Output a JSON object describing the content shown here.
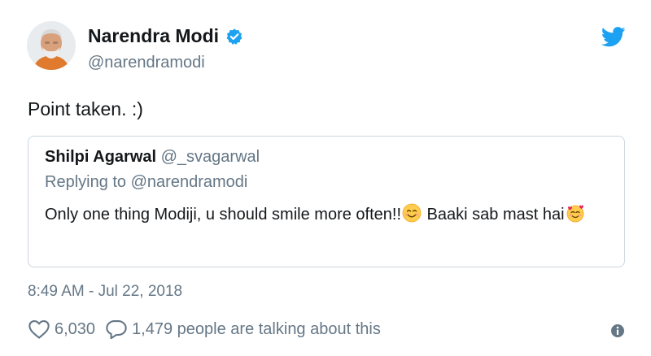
{
  "author": {
    "name": "Narendra Modi",
    "handle": "@narendramodi"
  },
  "tweet": {
    "text": "Point taken. :)"
  },
  "quoted_tweet": {
    "name": "Shilpi Agarwal",
    "handle": "@_svagarwal",
    "replying_to": "Replying to @narendramodi",
    "text_part1": "Only one thing Modiji, u should smile more often!!",
    "text_part2": " Baaki sab mast hai"
  },
  "timestamp": "8:49 AM - Jul 22, 2018",
  "stats": {
    "likes": "6,030",
    "talking": "1,479 people are talking about this"
  },
  "colors": {
    "twitter_blue": "#1da1f2",
    "secondary_text": "#657786",
    "border": "#ccd6dd"
  },
  "icons": {
    "verified": "verified-badge-icon",
    "bird": "twitter-bird-icon",
    "like": "heart-outline-icon",
    "reply": "speech-bubble-icon",
    "info": "info-circle-icon",
    "emoji1": "smiling-face-icon",
    "emoji2": "smiling-face-with-hearts-icon"
  }
}
